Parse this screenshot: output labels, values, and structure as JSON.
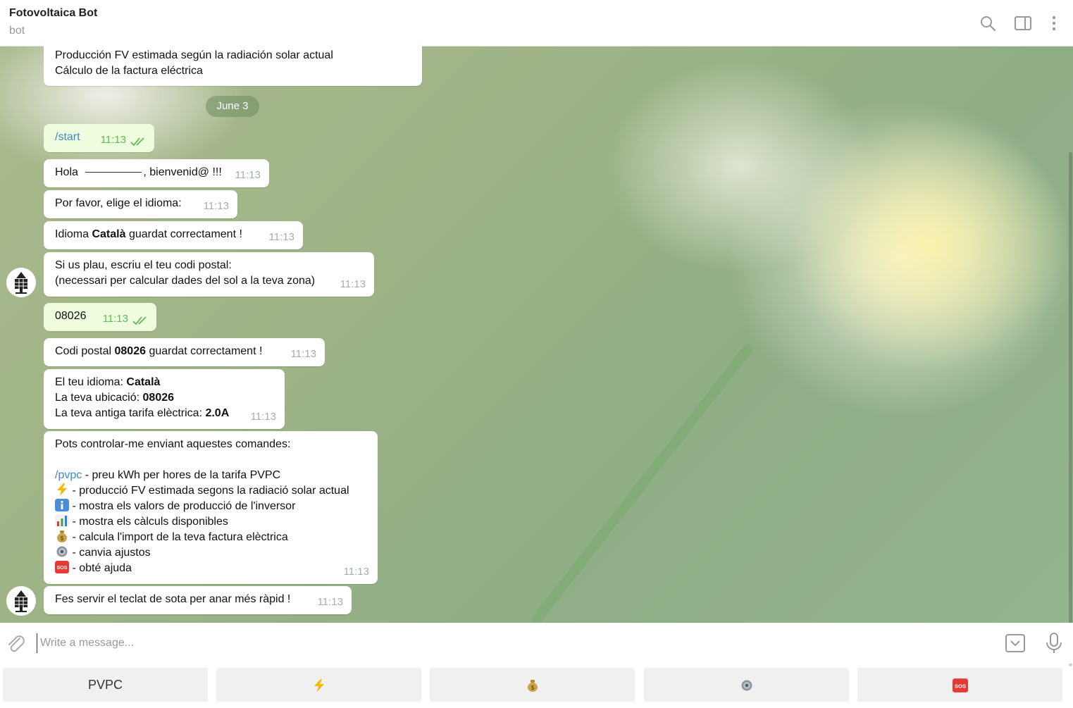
{
  "header": {
    "title": "Fotovoltaica Bot",
    "subtitle": "bot",
    "icons": [
      "search-icon",
      "sidebar-toggle-icon",
      "more-vertical-icon"
    ]
  },
  "messages": {
    "m0": {
      "line1": "Producción FV estimada según la radiación solar actual",
      "line2": "Cálculo de la factura eléctrica"
    },
    "date": "June 3",
    "m1": {
      "text": "/start",
      "time": "11:13"
    },
    "m2": {
      "pre": "Hola",
      "post": ", bienvenid@ !!!",
      "time": "11:13"
    },
    "m3": {
      "text": "Por favor, elige el idioma:",
      "time": "11:13"
    },
    "m4": {
      "pre": "Idioma ",
      "bold": "Català",
      "post": " guardat correctament !",
      "time": "11:13"
    },
    "m5": {
      "line1": "Si us plau, escriu el teu codi postal:",
      "line2": "(necessari per calcular dades del sol a la teva zona)",
      "time": "11:13"
    },
    "m6": {
      "text": "08026",
      "time": "11:13"
    },
    "m7": {
      "pre": "Codi postal ",
      "bold": "08026",
      "post": " guardat correctament !",
      "time": "11:13"
    },
    "m8": {
      "l1_label": "El teu idioma: ",
      "l1_value": "Català",
      "l2_label": "La teva ubicació: ",
      "l2_value": "08026",
      "l3_label": "La teva antiga tarifa elèctrica: ",
      "l3_value": "2.0A",
      "time": "11:13"
    },
    "m9": {
      "intro": "Pots controlar-me enviant aquestes comandes:",
      "pvpc_cmd": "/pvpc",
      "pvpc_desc": " - preu kWh per hores de la tarifa PVPC",
      "items": [
        {
          "icon": "lightning-icon",
          "text": " - producció FV estimada segons la radiació solar actual"
        },
        {
          "icon": "info-icon",
          "text": " - mostra els valors de producció de l'inversor"
        },
        {
          "icon": "bar-chart-icon",
          "text": " - mostra els càlculs disponibles"
        },
        {
          "icon": "money-bag-icon",
          "text": " - calcula l'import de la teva factura elèctrica"
        },
        {
          "icon": "gear-icon",
          "text": " - canvia ajustos"
        },
        {
          "icon": "sos-icon",
          "text": " - obté ajuda"
        }
      ],
      "time": "11:13"
    },
    "m10": {
      "text": "Fes servir el teclat de sota per anar més ràpid !",
      "time": "11:13"
    }
  },
  "composer": {
    "placeholder": "Write a message..."
  },
  "keyboard": [
    {
      "label": "PVPC"
    },
    {
      "icon": "lightning-icon"
    },
    {
      "icon": "money-bag-icon"
    },
    {
      "icon": "gear-icon"
    },
    {
      "icon": "sos-icon"
    }
  ],
  "colors": {
    "accent": "#3a8ac8",
    "outgoing_bubble": "#effdde",
    "check": "#5dbc56",
    "sos": "#e53935",
    "lightning": "#f5b800"
  }
}
